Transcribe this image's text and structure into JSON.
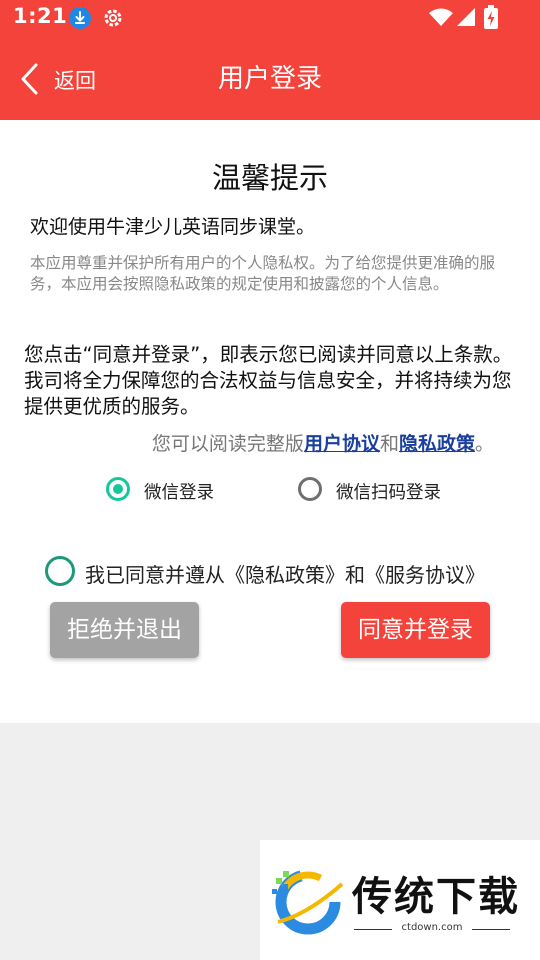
{
  "status_bar": {
    "time": "1:21"
  },
  "header": {
    "back_label": "返回",
    "title": "用户登录"
  },
  "dialog": {
    "heading": "温馨提示",
    "welcome": "欢迎使用牛津少儿英语同步课堂。",
    "notice": "本应用尊重并保护所有用户的个人隐私权。为了给您提供更准确的服务，本应用会按照隐私政策的规定使用和披露您的个人信息。",
    "consent": "您点击“同意并登录”，即表示您已阅读并同意以上条款。我司将全力保障您的合法权益与信息安全，并将持续为您提供更优质的服务。",
    "read_prefix": "您可以阅读完整版",
    "user_agreement_link": "用户协议",
    "read_and": "和",
    "privacy_link": "隐私政策",
    "read_suffix": "。"
  },
  "login_options": [
    {
      "label": "微信登录",
      "selected": true
    },
    {
      "label": "微信扫码登录",
      "selected": false
    }
  ],
  "agreement": {
    "label": "我已同意并遵从《隐私政策》和《服务协议》",
    "checked": false
  },
  "buttons": {
    "reject": "拒绝并退出",
    "accept": "同意并登录"
  },
  "watermark": {
    "text": "传统下载",
    "url": "ctdown.com"
  },
  "colors": {
    "primary": "#f4433b",
    "accent": "#16c79a",
    "link": "#1a3f9c",
    "reject_button": "#a3a3a3"
  }
}
